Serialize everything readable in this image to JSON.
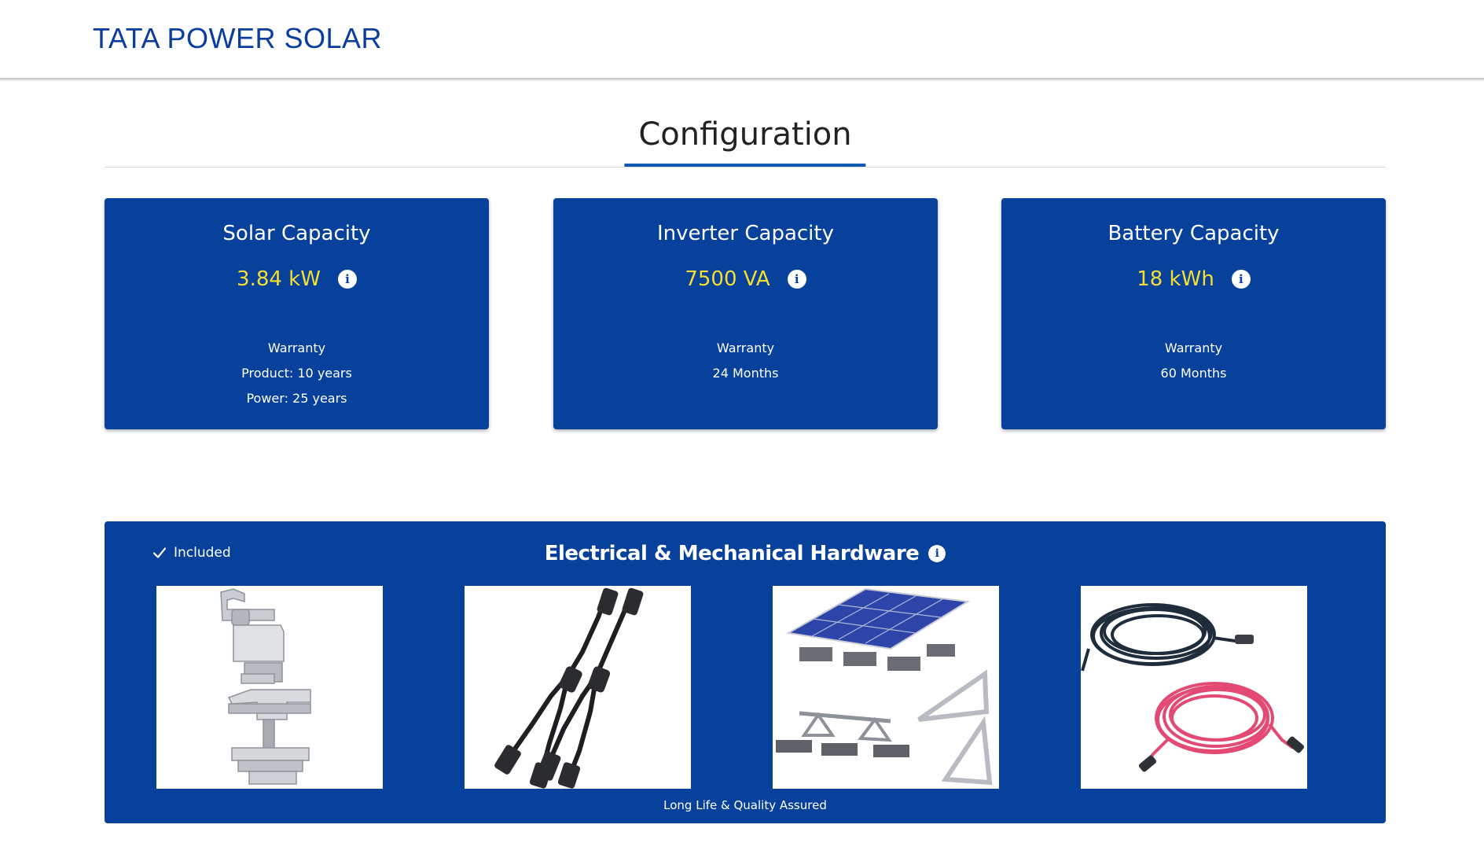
{
  "header": {
    "brand": "TATA POWER SOLAR"
  },
  "section": {
    "title": "Configuration"
  },
  "cards": [
    {
      "title": "Solar Capacity",
      "value": "3.84 kW",
      "warranty_label": "Warranty",
      "warranty_lines": [
        "Product: 10 years",
        "Power: 25 years"
      ]
    },
    {
      "title": "Inverter Capacity",
      "value": "7500 VA",
      "warranty_label": "Warranty",
      "warranty_lines": [
        "24 Months"
      ]
    },
    {
      "title": "Battery Capacity",
      "value": "18 kWh",
      "warranty_label": "Warranty",
      "warranty_lines": [
        "60 Months"
      ]
    }
  ],
  "hardware": {
    "included_label": "Included",
    "title": "Electrical & Mechanical Hardware",
    "footer": "Long Life & Quality Assured",
    "images": [
      {
        "icon": "mounting-clamp-image"
      },
      {
        "icon": "mc4-y-connector-image"
      },
      {
        "icon": "panel-mounting-structure-image"
      },
      {
        "icon": "solar-dc-cable-image"
      }
    ]
  },
  "colors": {
    "brand_blue": "#0a3d9e",
    "card_blue": "#08419b",
    "value_yellow": "#f5de2f",
    "heading_underline": "#0f5ab0"
  },
  "icons": {
    "info": "info-icon",
    "check": "check-icon"
  }
}
